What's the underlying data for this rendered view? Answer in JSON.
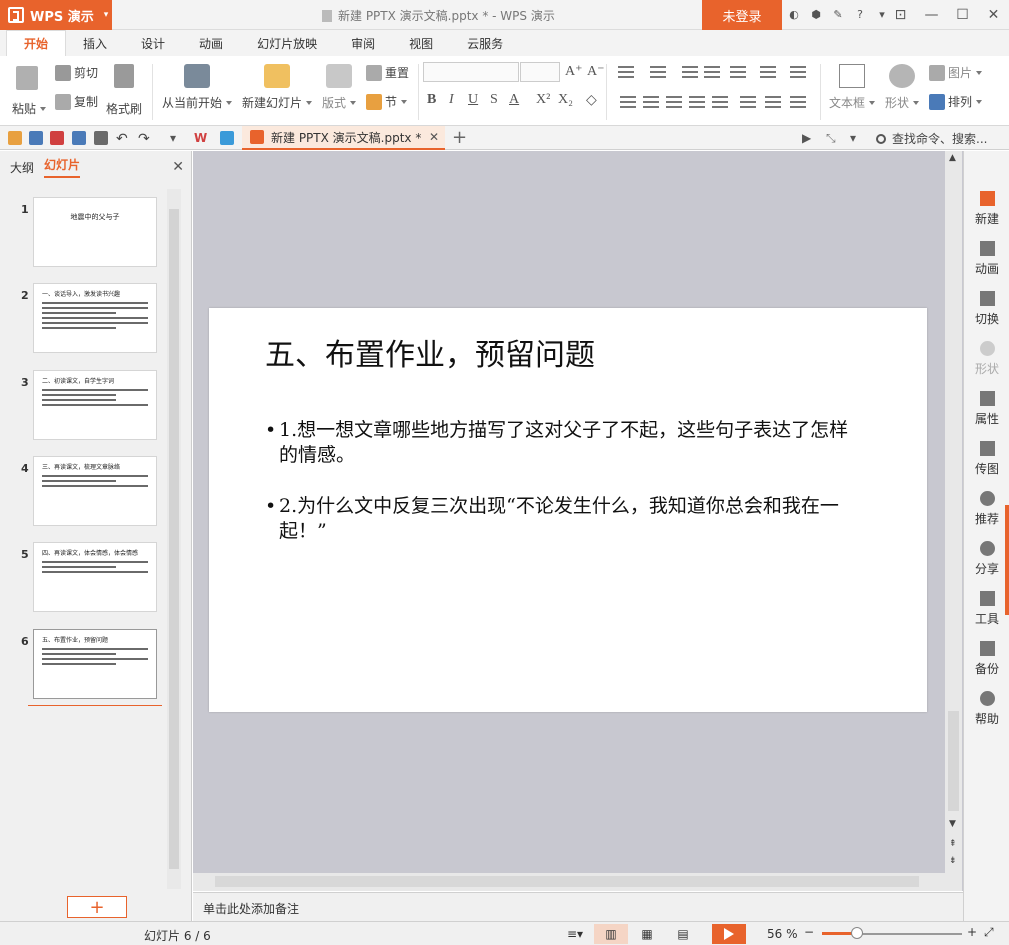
{
  "app": {
    "name": "WPS 演示",
    "window_title": "新建 PPTX 演示文稿.pptx * - WPS 演示",
    "login": "未登录"
  },
  "ribbon_tabs": [
    "开始",
    "插入",
    "设计",
    "动画",
    "幻灯片放映",
    "审阅",
    "视图",
    "云服务"
  ],
  "ribbon": {
    "paste": "粘贴",
    "cut": "剪切",
    "copy": "复制",
    "format_painter": "格式刷",
    "from_current": "从当前开始",
    "new_slide": "新建幻灯片",
    "layout": "版式",
    "reset": "重置",
    "section": "节",
    "textbox": "文本框",
    "shape": "形状",
    "picture": "图片",
    "arrange": "排列"
  },
  "doc_tab": {
    "title": "新建 PPTX 演示文稿.pptx *"
  },
  "search": {
    "placeholder": "查找命令、搜索..."
  },
  "left_panel": {
    "tab_outline": "大纲",
    "tab_slides": "幻灯片",
    "slides": [
      {
        "num": "1",
        "title": "地震中的父与子"
      },
      {
        "num": "2",
        "title": "一、谈话导入，激发读书兴趣"
      },
      {
        "num": "3",
        "title": "二、初读课文，自学生字词"
      },
      {
        "num": "4",
        "title": "三、再读课文，梳理文章脉络"
      },
      {
        "num": "5",
        "title": "四、再读课文，体会情感，体会情感"
      },
      {
        "num": "6",
        "title": "五、布置作业，预留问题"
      }
    ]
  },
  "slide": {
    "title": "五、布置作业，预留问题",
    "bullets": [
      "1.想一想文章哪些地方描写了这对父子了不起，这些句子表达了怎样的情感。",
      "2.为什么文中反复三次出现“不论发生什么，我知道你总会和我在一起！”"
    ]
  },
  "notes_placeholder": "单击此处添加备注",
  "right_sidebar": [
    "新建",
    "动画",
    "切换",
    "形状",
    "属性",
    "传图",
    "推荐",
    "分享",
    "工具",
    "备份",
    "帮助"
  ],
  "status": {
    "slide_count": "幻灯片 6 / 6",
    "zoom": "56 %"
  },
  "colors": {
    "accent": "#e8632c",
    "canvas_bg": "#c8c8d0"
  }
}
